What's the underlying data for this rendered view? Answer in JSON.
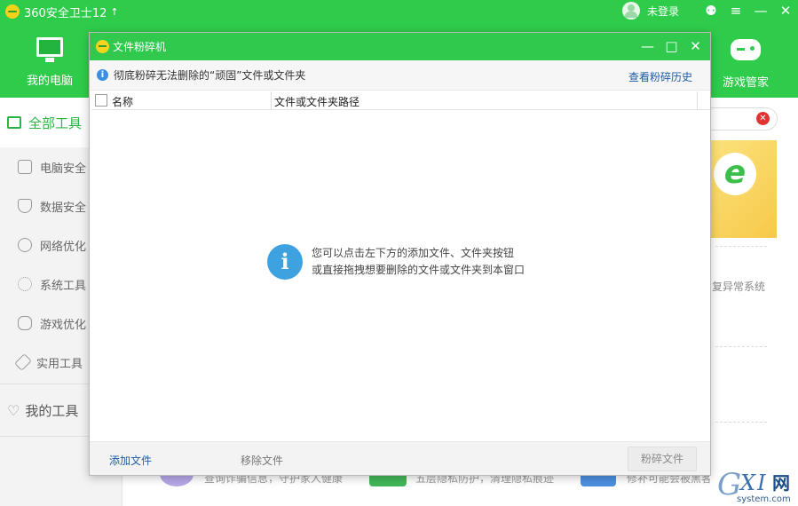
{
  "app": {
    "title": "360安全卫士12",
    "update_arrow": "↑",
    "login": "未登录",
    "ctl_skin": "⚉",
    "ctl_menu": "≡",
    "ctl_minimize": "—",
    "ctl_close": "✕",
    "tabs": {
      "my_computer": "我的电脑",
      "game_manager": "游戏管家"
    }
  },
  "sidebar": {
    "header": "全部工具",
    "items": [
      "电脑安全",
      "数据安全",
      "网络优化",
      "系统工具",
      "游戏优化",
      "实用工具"
    ],
    "favorites": "我的工具"
  },
  "background": {
    "clear_icon": "✕",
    "banner_letter": "e",
    "partial_text": "复异常系统",
    "bottom_texts": [
      "查询诈骗信息，守护家人健康",
      "五层隐私防护，清理隐私痕迹",
      "修补可能会被黑客"
    ]
  },
  "dialog": {
    "title": "文件粉碎机",
    "ctl_minimize": "—",
    "ctl_maximize": "□",
    "ctl_close": "✕",
    "info_icon": "i",
    "info_text": "彻底粉碎无法删除的“顽固”文件或文件夹",
    "history_link": "查看粉碎历史",
    "columns": {
      "name": "名称",
      "path": "文件或文件夹路径"
    },
    "hint_icon": "i",
    "hint_lines": [
      "您可以点击左下方的添加文件、文件夹按钮",
      "或直接拖拽想要删除的文件或文件夹到本窗口"
    ],
    "footer": {
      "add_file": "添加文件",
      "remove_file": "移除文件",
      "shred": "粉碎文件"
    }
  },
  "watermark": {
    "g": "G",
    "xi": "XI",
    "net": "网",
    "sub": "system.com"
  },
  "colors": {
    "brand_green": "#2fcc4c",
    "link_blue": "#1e5ca8",
    "info_blue": "#3ea2e0"
  }
}
